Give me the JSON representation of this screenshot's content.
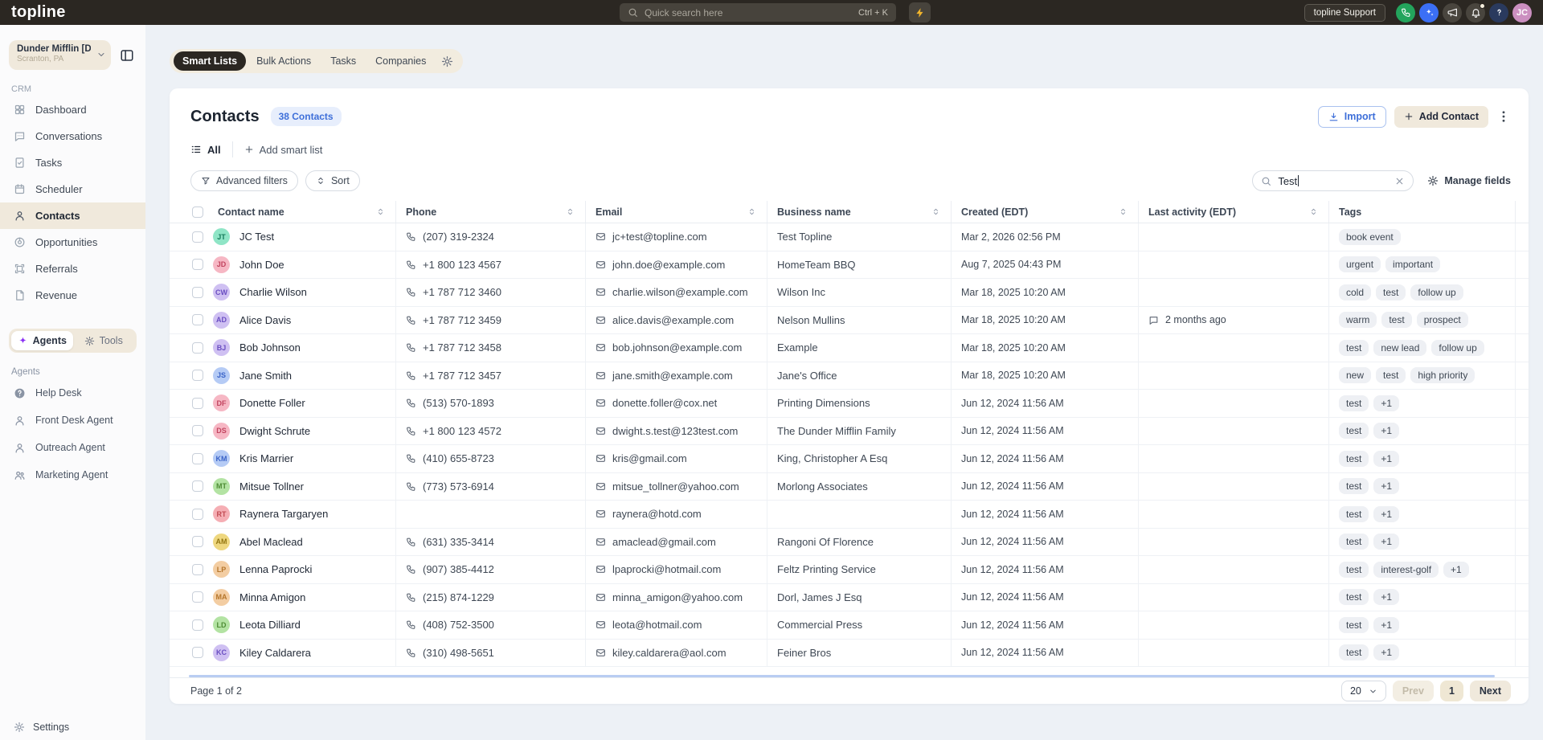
{
  "topbar": {
    "logo": "topline",
    "search_placeholder": "Quick search here",
    "search_shortcut": "Ctrl + K",
    "support_label": "topline Support",
    "icons": [
      {
        "name": "phone-call",
        "icon": "phone",
        "color": "#23a45c"
      },
      {
        "name": "ai-sparkles",
        "icon": "sparkles",
        "color": "#3b6ff5"
      },
      {
        "name": "announcements-megaphone",
        "icon": "megaphone",
        "color": "#49453e"
      },
      {
        "name": "notifications-bell",
        "icon": "bell",
        "color": "#49453e",
        "badge": true
      },
      {
        "name": "help",
        "icon": "question",
        "color": "#2a3a5e"
      },
      {
        "name": "user-avatar",
        "glyph": "JC",
        "color": "#cb8fc0"
      }
    ]
  },
  "sidebar": {
    "workspace": {
      "name": "Dunder Mifflin [D...",
      "location": "Scranton, PA"
    },
    "crm_label": "CRM",
    "items": [
      {
        "label": "Dashboard",
        "icon": "grid",
        "active": false
      },
      {
        "label": "Conversations",
        "icon": "chat-dots",
        "active": false
      },
      {
        "label": "Tasks",
        "icon": "task",
        "active": false
      },
      {
        "label": "Scheduler",
        "icon": "calendar",
        "active": false
      },
      {
        "label": "Contacts",
        "icon": "person",
        "active": true
      },
      {
        "label": "Opportunities",
        "icon": "target",
        "active": false
      },
      {
        "label": "Referrals",
        "icon": "box",
        "active": false
      },
      {
        "label": "Revenue",
        "icon": "doc",
        "active": false
      }
    ],
    "toggle": {
      "agents": "Agents",
      "tools": "Tools"
    },
    "agents_label": "Agents",
    "agents": [
      {
        "label": "Help Desk",
        "icon": "help-circle"
      },
      {
        "label": "Front Desk Agent",
        "icon": "person"
      },
      {
        "label": "Outreach Agent",
        "icon": "person"
      },
      {
        "label": "Marketing Agent",
        "icon": "people"
      }
    ],
    "settings_label": "Settings"
  },
  "workspace_tabs": [
    "Smart Lists",
    "Bulk Actions",
    "Tasks",
    "Companies"
  ],
  "main": {
    "title": "Contacts",
    "count_badge": "38 Contacts",
    "import_label": "Import",
    "add_contact_label": "Add Contact",
    "all_tab_label": "All",
    "add_smart_list_label": "Add smart list",
    "filters": {
      "advanced_label": "Advanced filters",
      "sort_label": "Sort",
      "search_value": "Test",
      "manage_fields_label": "Manage fields"
    },
    "table": {
      "columns": [
        {
          "label": "Contact name",
          "sortable": true
        },
        {
          "label": "Phone",
          "sortable": true
        },
        {
          "label": "Email",
          "sortable": true
        },
        {
          "label": "Business name",
          "sortable": true
        },
        {
          "label": "Created (EDT)",
          "sortable": true
        },
        {
          "label": "Last activity (EDT)",
          "sortable": true
        },
        {
          "label": "Tags",
          "sortable": false
        }
      ],
      "rows": [
        {
          "initials": "JT",
          "avatar": "teal",
          "name": "JC Test",
          "phone": "(207) 319-2324",
          "email": "jc+test@topline.com",
          "business": "Test Topline",
          "created": "Mar 2, 2026 02:56 PM",
          "activity": "",
          "tags": [
            "book event"
          ]
        },
        {
          "initials": "JD",
          "avatar": "pink",
          "name": "John Doe",
          "phone": "+1 800 123 4567",
          "email": "john.doe@example.com",
          "business": "HomeTeam BBQ",
          "created": "Aug 7, 2025 04:43 PM",
          "activity": "",
          "tags": [
            "urgent",
            "important"
          ]
        },
        {
          "initials": "CW",
          "avatar": "purple",
          "name": "Charlie Wilson",
          "phone": "+1 787 712 3460",
          "email": "charlie.wilson@example.com",
          "business": "Wilson Inc",
          "created": "Mar 18, 2025 10:20 AM",
          "activity": "",
          "tags": [
            "cold",
            "test",
            "follow up"
          ]
        },
        {
          "initials": "AD",
          "avatar": "purple",
          "name": "Alice Davis",
          "phone": "+1 787 712 3459",
          "email": "alice.davis@example.com",
          "business": "Nelson Mullins",
          "created": "Mar 18, 2025 10:20 AM",
          "activity": "2 months ago",
          "tags": [
            "warm",
            "test",
            "prospect"
          ]
        },
        {
          "initials": "BJ",
          "avatar": "purple",
          "name": "Bob Johnson",
          "phone": "+1 787 712 3458",
          "email": "bob.johnson@example.com",
          "business": "Example",
          "created": "Mar 18, 2025 10:20 AM",
          "activity": "",
          "tags": [
            "test",
            "new lead",
            "follow up"
          ]
        },
        {
          "initials": "JS",
          "avatar": "blue",
          "name": "Jane Smith",
          "phone": "+1 787 712 3457",
          "email": "jane.smith@example.com",
          "business": "Jane's Office",
          "created": "Mar 18, 2025 10:20 AM",
          "activity": "",
          "tags": [
            "new",
            "test",
            "high priority"
          ]
        },
        {
          "initials": "DF",
          "avatar": "pink",
          "name": "Donette Foller",
          "phone": "(513) 570-1893",
          "email": "donette.foller@cox.net",
          "business": "Printing Dimensions",
          "created": "Jun 12, 2024 11:56 AM",
          "activity": "",
          "tags": [
            "test",
            "+1"
          ]
        },
        {
          "initials": "DS",
          "avatar": "pink",
          "name": "Dwight Schrute",
          "phone": "+1 800 123 4572",
          "email": "dwight.s.test@123test.com",
          "business": "The Dunder Mifflin Family",
          "created": "Jun 12, 2024 11:56 AM",
          "activity": "",
          "tags": [
            "test",
            "+1"
          ]
        },
        {
          "initials": "KM",
          "avatar": "blue",
          "name": "Kris Marrier",
          "phone": "(410) 655-8723",
          "email": "kris@gmail.com",
          "business": "King, Christopher A Esq",
          "created": "Jun 12, 2024 11:56 AM",
          "activity": "",
          "tags": [
            "test",
            "+1"
          ]
        },
        {
          "initials": "MT",
          "avatar": "green",
          "name": "Mitsue Tollner",
          "phone": "(773) 573-6914",
          "email": "mitsue_tollner@yahoo.com",
          "business": "Morlong Associates",
          "created": "Jun 12, 2024 11:56 AM",
          "activity": "",
          "tags": [
            "test",
            "+1"
          ]
        },
        {
          "initials": "RT",
          "avatar": "red",
          "name": "Raynera Targaryen",
          "phone": "",
          "email": "raynera@hotd.com",
          "business": "",
          "created": "Jun 12, 2024 11:56 AM",
          "activity": "",
          "tags": [
            "test",
            "+1"
          ]
        },
        {
          "initials": "AM",
          "avatar": "yellow",
          "name": "Abel Maclead",
          "phone": "(631) 335-3414",
          "email": "amaclead@gmail.com",
          "business": "Rangoni Of Florence",
          "created": "Jun 12, 2024 11:56 AM",
          "activity": "",
          "tags": [
            "test",
            "+1"
          ]
        },
        {
          "initials": "LP",
          "avatar": "orange",
          "name": "Lenna Paprocki",
          "phone": "(907) 385-4412",
          "email": "lpaprocki@hotmail.com",
          "business": "Feltz Printing Service",
          "created": "Jun 12, 2024 11:56 AM",
          "activity": "",
          "tags": [
            "test",
            "interest-golf",
            "+1"
          ]
        },
        {
          "initials": "MA",
          "avatar": "orange",
          "name": "Minna Amigon",
          "phone": "(215) 874-1229",
          "email": "minna_amigon@yahoo.com",
          "business": "Dorl, James J Esq",
          "created": "Jun 12, 2024 11:56 AM",
          "activity": "",
          "tags": [
            "test",
            "+1"
          ]
        },
        {
          "initials": "LD",
          "avatar": "green",
          "name": "Leota Dilliard",
          "phone": "(408) 752-3500",
          "email": "leota@hotmail.com",
          "business": "Commercial Press",
          "created": "Jun 12, 2024 11:56 AM",
          "activity": "",
          "tags": [
            "test",
            "+1"
          ]
        },
        {
          "initials": "KC",
          "avatar": "purple",
          "name": "Kiley Caldarera",
          "phone": "(310) 498-5651",
          "email": "kiley.caldarera@aol.com",
          "business": "Feiner Bros",
          "created": "Jun 12, 2024 11:56 AM",
          "activity": "",
          "tags": [
            "test",
            "+1"
          ]
        }
      ]
    },
    "pagination": {
      "page_info": "Page 1 of 2",
      "page_size": "20",
      "prev_label": "Prev",
      "current_page": "1",
      "next_label": "Next"
    }
  },
  "colors": {
    "topbar_bg": "#2b2722",
    "accent_beige": "#f0e9dc",
    "accent_blue": "#3e6fd9",
    "bolt_yellow": "#f2b52b",
    "active_pill_dark": "#2b2722"
  }
}
